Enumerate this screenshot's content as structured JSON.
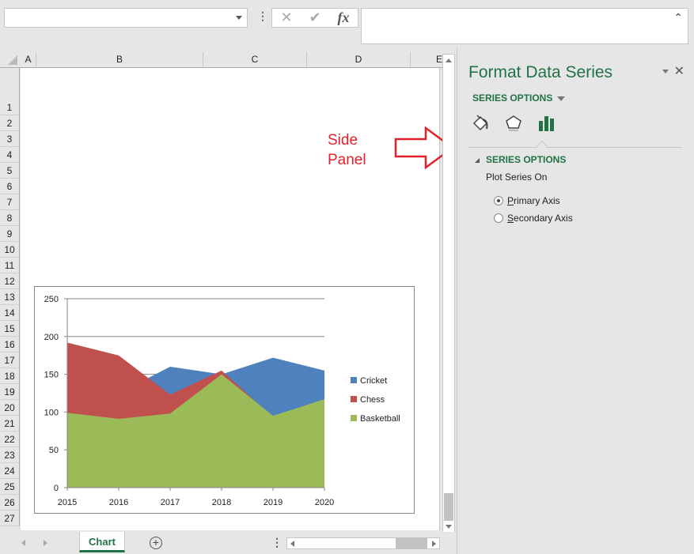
{
  "formula_bar": {
    "name_box_value": "",
    "formula_value": "",
    "cancel_icon": "x-icon",
    "enter_icon": "check-icon",
    "fx_label": "fx"
  },
  "columns": [
    "A",
    "B",
    "C",
    "D",
    "E"
  ],
  "rows": [
    "1",
    "2",
    "3",
    "4",
    "5",
    "6",
    "7",
    "8",
    "9",
    "10",
    "11",
    "12",
    "13",
    "14",
    "15",
    "16",
    "17",
    "18",
    "19",
    "20",
    "21",
    "22",
    "23",
    "24",
    "25",
    "26",
    "27"
  ],
  "annotation": {
    "text_line1": "Side",
    "text_line2": "Panel",
    "color": "#e4212b"
  },
  "sheet_tabs": [
    {
      "label": "Chart",
      "active": true
    }
  ],
  "panel": {
    "title": "Format Data Series",
    "dropdown_label": "SERIES OPTIONS",
    "icons": [
      "fill-line-icon",
      "effects-pentagon-icon",
      "series-options-bars-icon"
    ],
    "section_title": "SERIES OPTIONS",
    "plot_series_on_label": "Plot Series On",
    "radio_options": [
      {
        "label_underlined": "P",
        "label_rest": "rimary Axis",
        "selected": true
      },
      {
        "label_underlined": "S",
        "label_rest": "econdary Axis",
        "selected": false
      }
    ],
    "accent_color": "#217346"
  },
  "chart_data": {
    "type": "area",
    "title": "",
    "xlabel": "",
    "ylabel": "",
    "categories": [
      "2015",
      "2016",
      "2017",
      "2018",
      "2019",
      "2020"
    ],
    "ylim": [
      0,
      250
    ],
    "yticks": [
      0,
      50,
      100,
      150,
      200,
      250
    ],
    "grid": true,
    "legend_position": "right",
    "series": [
      {
        "name": "Cricket",
        "color": "#4f81bd",
        "values": [
          120,
          125,
          160,
          150,
          172,
          155
        ]
      },
      {
        "name": "Chess",
        "color": "#c0504d",
        "values": [
          192,
          175,
          123,
          155,
          93,
          90
        ]
      },
      {
        "name": "Basketball",
        "color": "#9bbb59",
        "values": [
          99,
          91,
          98,
          150,
          95,
          117
        ]
      }
    ]
  }
}
